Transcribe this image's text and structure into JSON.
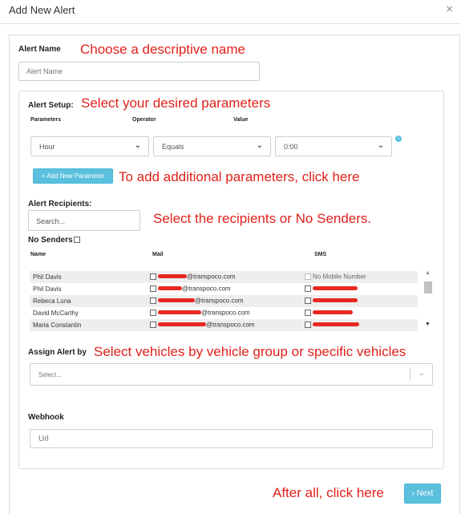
{
  "dialog": {
    "title": "Add New Alert",
    "close_symbol": "×"
  },
  "alert_name": {
    "label": "Alert Name",
    "placeholder": "Alert Name",
    "annotation": "Choose a descriptive name"
  },
  "alert_setup": {
    "label": "Alert Setup:",
    "annotation": "Select your desired parameters",
    "columns": {
      "parameters": "Parameters",
      "operator": "Operator",
      "value": "Value"
    },
    "parameter_value": "Hour",
    "operator_value": "Equals",
    "value_value": "0:00",
    "add_button": "+ Add New Parameter",
    "add_annotation": "To add additional parameters, click here"
  },
  "recipients": {
    "label": "Alert Recipients:",
    "search_placeholder": "Search...",
    "annotation": "Select the recipients or No Senders.",
    "no_senders_label": "No Senders",
    "columns": {
      "name": "Name",
      "mail": "Mail",
      "sms": "SMS"
    },
    "rows": [
      {
        "name": "Phil Davis",
        "mail": "@transpoco.com",
        "sms": "No Mobile Number"
      },
      {
        "name": "Phil Davis",
        "mail": "@transpoco.com",
        "sms": ""
      },
      {
        "name": "Rebeca Luna",
        "mail": "@transpoco.com",
        "sms": ""
      },
      {
        "name": "David McCarthy",
        "mail": "@transpoco.com",
        "sms": ""
      },
      {
        "name": "Maria Constantin",
        "mail": "@transpoco.com",
        "sms": ""
      }
    ]
  },
  "assign": {
    "label": "Assign Alert by",
    "annotation": "Select vehicles by vehicle group or specific vehicles",
    "placeholder": "Select..."
  },
  "webhook": {
    "label": "Webhook",
    "placeholder": "Url"
  },
  "footer": {
    "annotation": "After all, click here",
    "next_button": "› Next"
  },
  "colors": {
    "accent": "#5bc0de",
    "annotation": "#e0211b"
  }
}
